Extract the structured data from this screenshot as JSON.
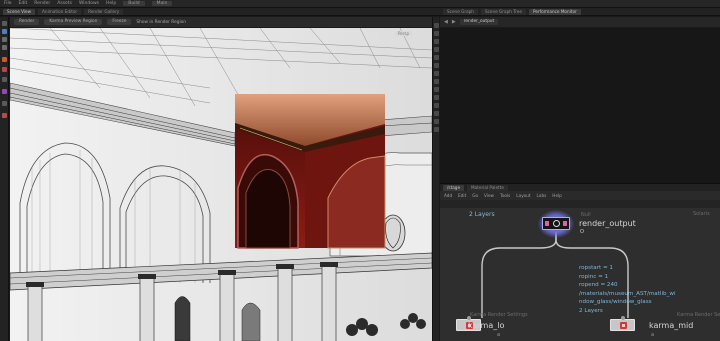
{
  "menubar": {
    "items": [
      "File",
      "Edit",
      "Render",
      "Assets",
      "Windows",
      "Help"
    ],
    "build_label": "Build",
    "main_label": "Main"
  },
  "viewport": {
    "tabs": [
      "Scene View",
      "Animation Editor",
      "Render Gallery"
    ],
    "toolbar": [
      "Render",
      "Karma Preview Region",
      "Freeze",
      "Show in Render Region"
    ],
    "camera_label": "Persp"
  },
  "output_pane": {
    "tabs": [
      "Scene Graph",
      "Scene Graph Tree",
      "Performance Monitor"
    ],
    "path": "render_output"
  },
  "network": {
    "tabs": [
      "/stage",
      "Material Palette"
    ],
    "menu": [
      "Add",
      "Edit",
      "Go",
      "View",
      "Tools",
      "Layout",
      "Labs",
      "Help"
    ],
    "context_label": "Solaris",
    "layers_top": "2 Layers",
    "render_node": {
      "type": "Null",
      "name": "render_output",
      "status_glyph": "O",
      "params": [
        "ropstart = 1",
        "ropinc = 1",
        "ropend = 240",
        "/materials/museum_AST/matlib_wi",
        "ndow_glass/window_glass",
        "2 Layers"
      ]
    },
    "karma_lo": {
      "type": "Karma Render Settings",
      "name": "karma_lo",
      "status_glyph": "a"
    },
    "karma_mid": {
      "type": "Karma Render Settings",
      "name": "karma_mid",
      "status_glyph": "a"
    }
  },
  "colors": {
    "wire": "#c9c9c9",
    "param_text": "#7fb7d9",
    "render_preview_wall": "#7a1a14",
    "render_preview_cornice": "#c47a52"
  }
}
